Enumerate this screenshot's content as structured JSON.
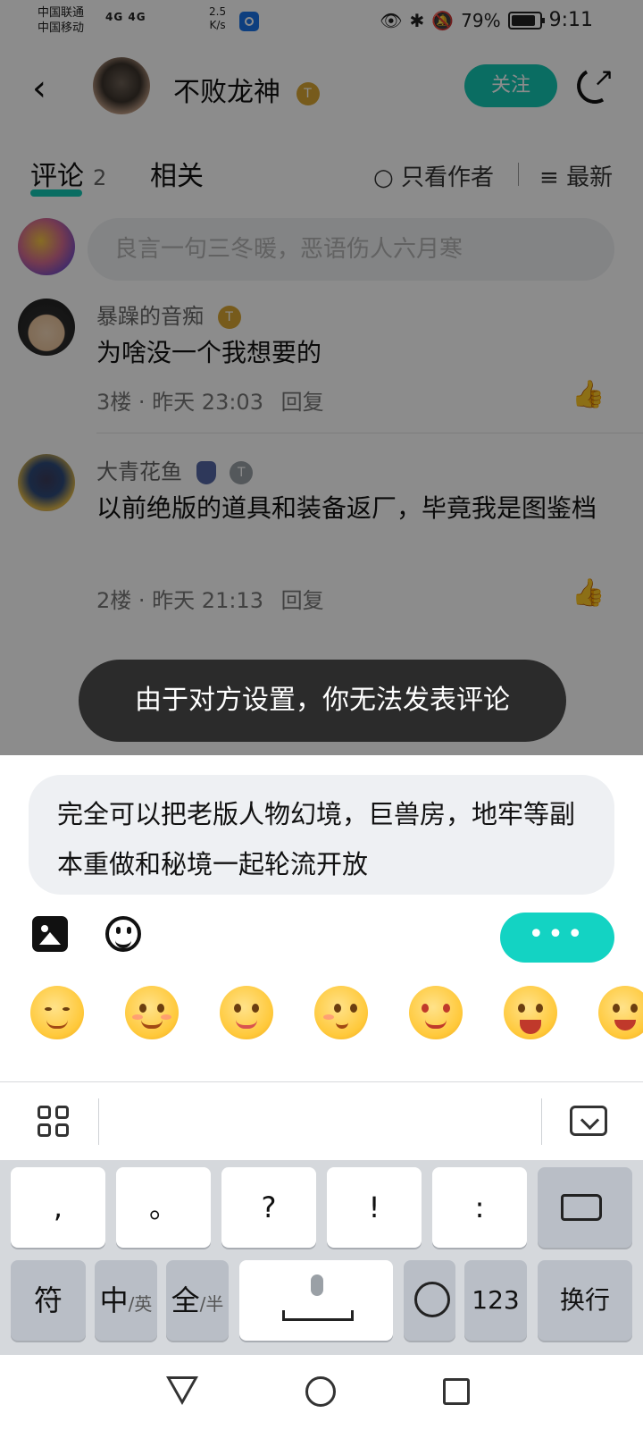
{
  "status_bar": {
    "carrier_1": "中国联通",
    "carrier_2": "中国移动",
    "network": "4G 4G",
    "speed_value": "2.5",
    "speed_unit": "K/s",
    "battery": "79%",
    "time": "9:11"
  },
  "header": {
    "author_name": "不败龙神",
    "level_badge": "T",
    "follow_label": "关注"
  },
  "tabs": {
    "comments_label": "评论",
    "comments_count": "2",
    "related_label": "相关",
    "only_author_label": "只看作者",
    "sort_label": "最新"
  },
  "comment_input": {
    "placeholder": "良言一句三冬暖，恶语伤人六月寒"
  },
  "comments": [
    {
      "name": "暴躁的音痴",
      "badge": "T",
      "text": "为啥没一个我想要的",
      "floor": "3楼",
      "time": "昨天 23:03",
      "reply_label": "回复"
    },
    {
      "name": "大青花鱼",
      "badge": "T",
      "text": "以前绝版的道具和装备返厂，毕竟我是图鉴档",
      "floor": "2楼",
      "time": "昨天 21:13",
      "reply_label": "回复"
    }
  ],
  "toast": {
    "message": "由于对方设置，你无法发表评论"
  },
  "reply_sheet": {
    "draft_text": "完全可以把老版人物幻境，巨兽房，地牢等副本重做和秘境一起轮流开放",
    "send_label": "•••"
  },
  "emoji_bar": {
    "items": [
      "smirk-emoji",
      "happy-emoji",
      "drooling-emoji",
      "cute-emoji",
      "mind-blown-emoji",
      "laughing-emoji",
      "crying-emoji"
    ]
  },
  "keyboard": {
    "row1": [
      ",",
      "。",
      "?",
      "!",
      ":"
    ],
    "symbols_label": "符",
    "cn_label": "中",
    "en_label": "/英",
    "full_label": "全",
    "half_label": "/半",
    "numbers_label": "123",
    "enter_label": "换行"
  },
  "colors": {
    "accent": "#13c6b3",
    "toast_bg": "#2b2b2b",
    "overlay": "rgba(0,0,0,0.45)"
  }
}
